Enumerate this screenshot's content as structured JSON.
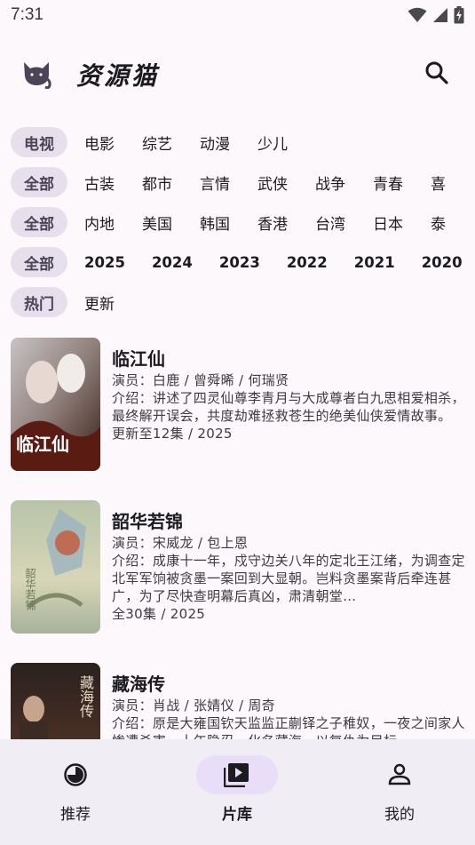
{
  "status_bar": {
    "time": "7:31"
  },
  "app_bar": {
    "title": "资源猫",
    "logo_icon": "cat-icon",
    "search_icon": "search-icon"
  },
  "filters": {
    "rows": [
      {
        "chip": "电视",
        "options": [
          "电影",
          "综艺",
          "动漫",
          "少儿"
        ]
      },
      {
        "chip": "全部",
        "options": [
          "古装",
          "都市",
          "言情",
          "武侠",
          "战争",
          "青春",
          "喜"
        ]
      },
      {
        "chip": "全部",
        "options": [
          "内地",
          "美国",
          "韩国",
          "香港",
          "台湾",
          "日本",
          "泰"
        ]
      },
      {
        "chip": "全部",
        "options": [
          "2025",
          "2024",
          "2023",
          "2022",
          "2021",
          "2020"
        ]
      },
      {
        "chip": "热门",
        "options": [
          "更新"
        ]
      }
    ]
  },
  "items": [
    {
      "title": "临江仙",
      "actors": "演员：白鹿 / 曾舜晞 / 何瑞贤",
      "desc": "介绍：讲述了四灵仙尊李青月与大成尊者白九思相爱相杀，最终解开误会，共度劫难拯救苍生的绝美仙侠爱情故事。",
      "status": "更新至12集 / 2025",
      "poster_text": "临江仙"
    },
    {
      "title": "韶华若锦",
      "actors": "演员：宋威龙 / 包上恩",
      "desc": "介绍：成康十一年，戍守边关八年的定北王江绪，为调查定北军军饷被贪墨一案回到大显朝。岂料贪墨案背后牵连甚广，为了尽快查明幕后真凶，肃清朝堂…",
      "status": "全30集 / 2025",
      "poster_text": "韶华若锦"
    },
    {
      "title": "藏海传",
      "actors": "演员：肖战 / 张婧仪 / 周奇",
      "desc": "介绍：原是大雍国钦天监监正蒯铎之子稚奴，一夜之间家人惨遭杀害，十年隐忍，化名藏海，以复仇为目标……",
      "status": "",
      "poster_text": "藏海传"
    }
  ],
  "bottom_nav": {
    "items": [
      {
        "label": "推荐",
        "icon": "recommend-icon"
      },
      {
        "label": "片库",
        "icon": "library-icon"
      },
      {
        "label": "我的",
        "icon": "profile-icon"
      }
    ],
    "active": "片库"
  },
  "colors": {
    "background": "#FCF8FC",
    "chip_bg": "#E7E0EC",
    "nav_bg": "#F1EDF4",
    "nav_active_pill": "#E8DEF8",
    "accent": "#4A4458"
  }
}
